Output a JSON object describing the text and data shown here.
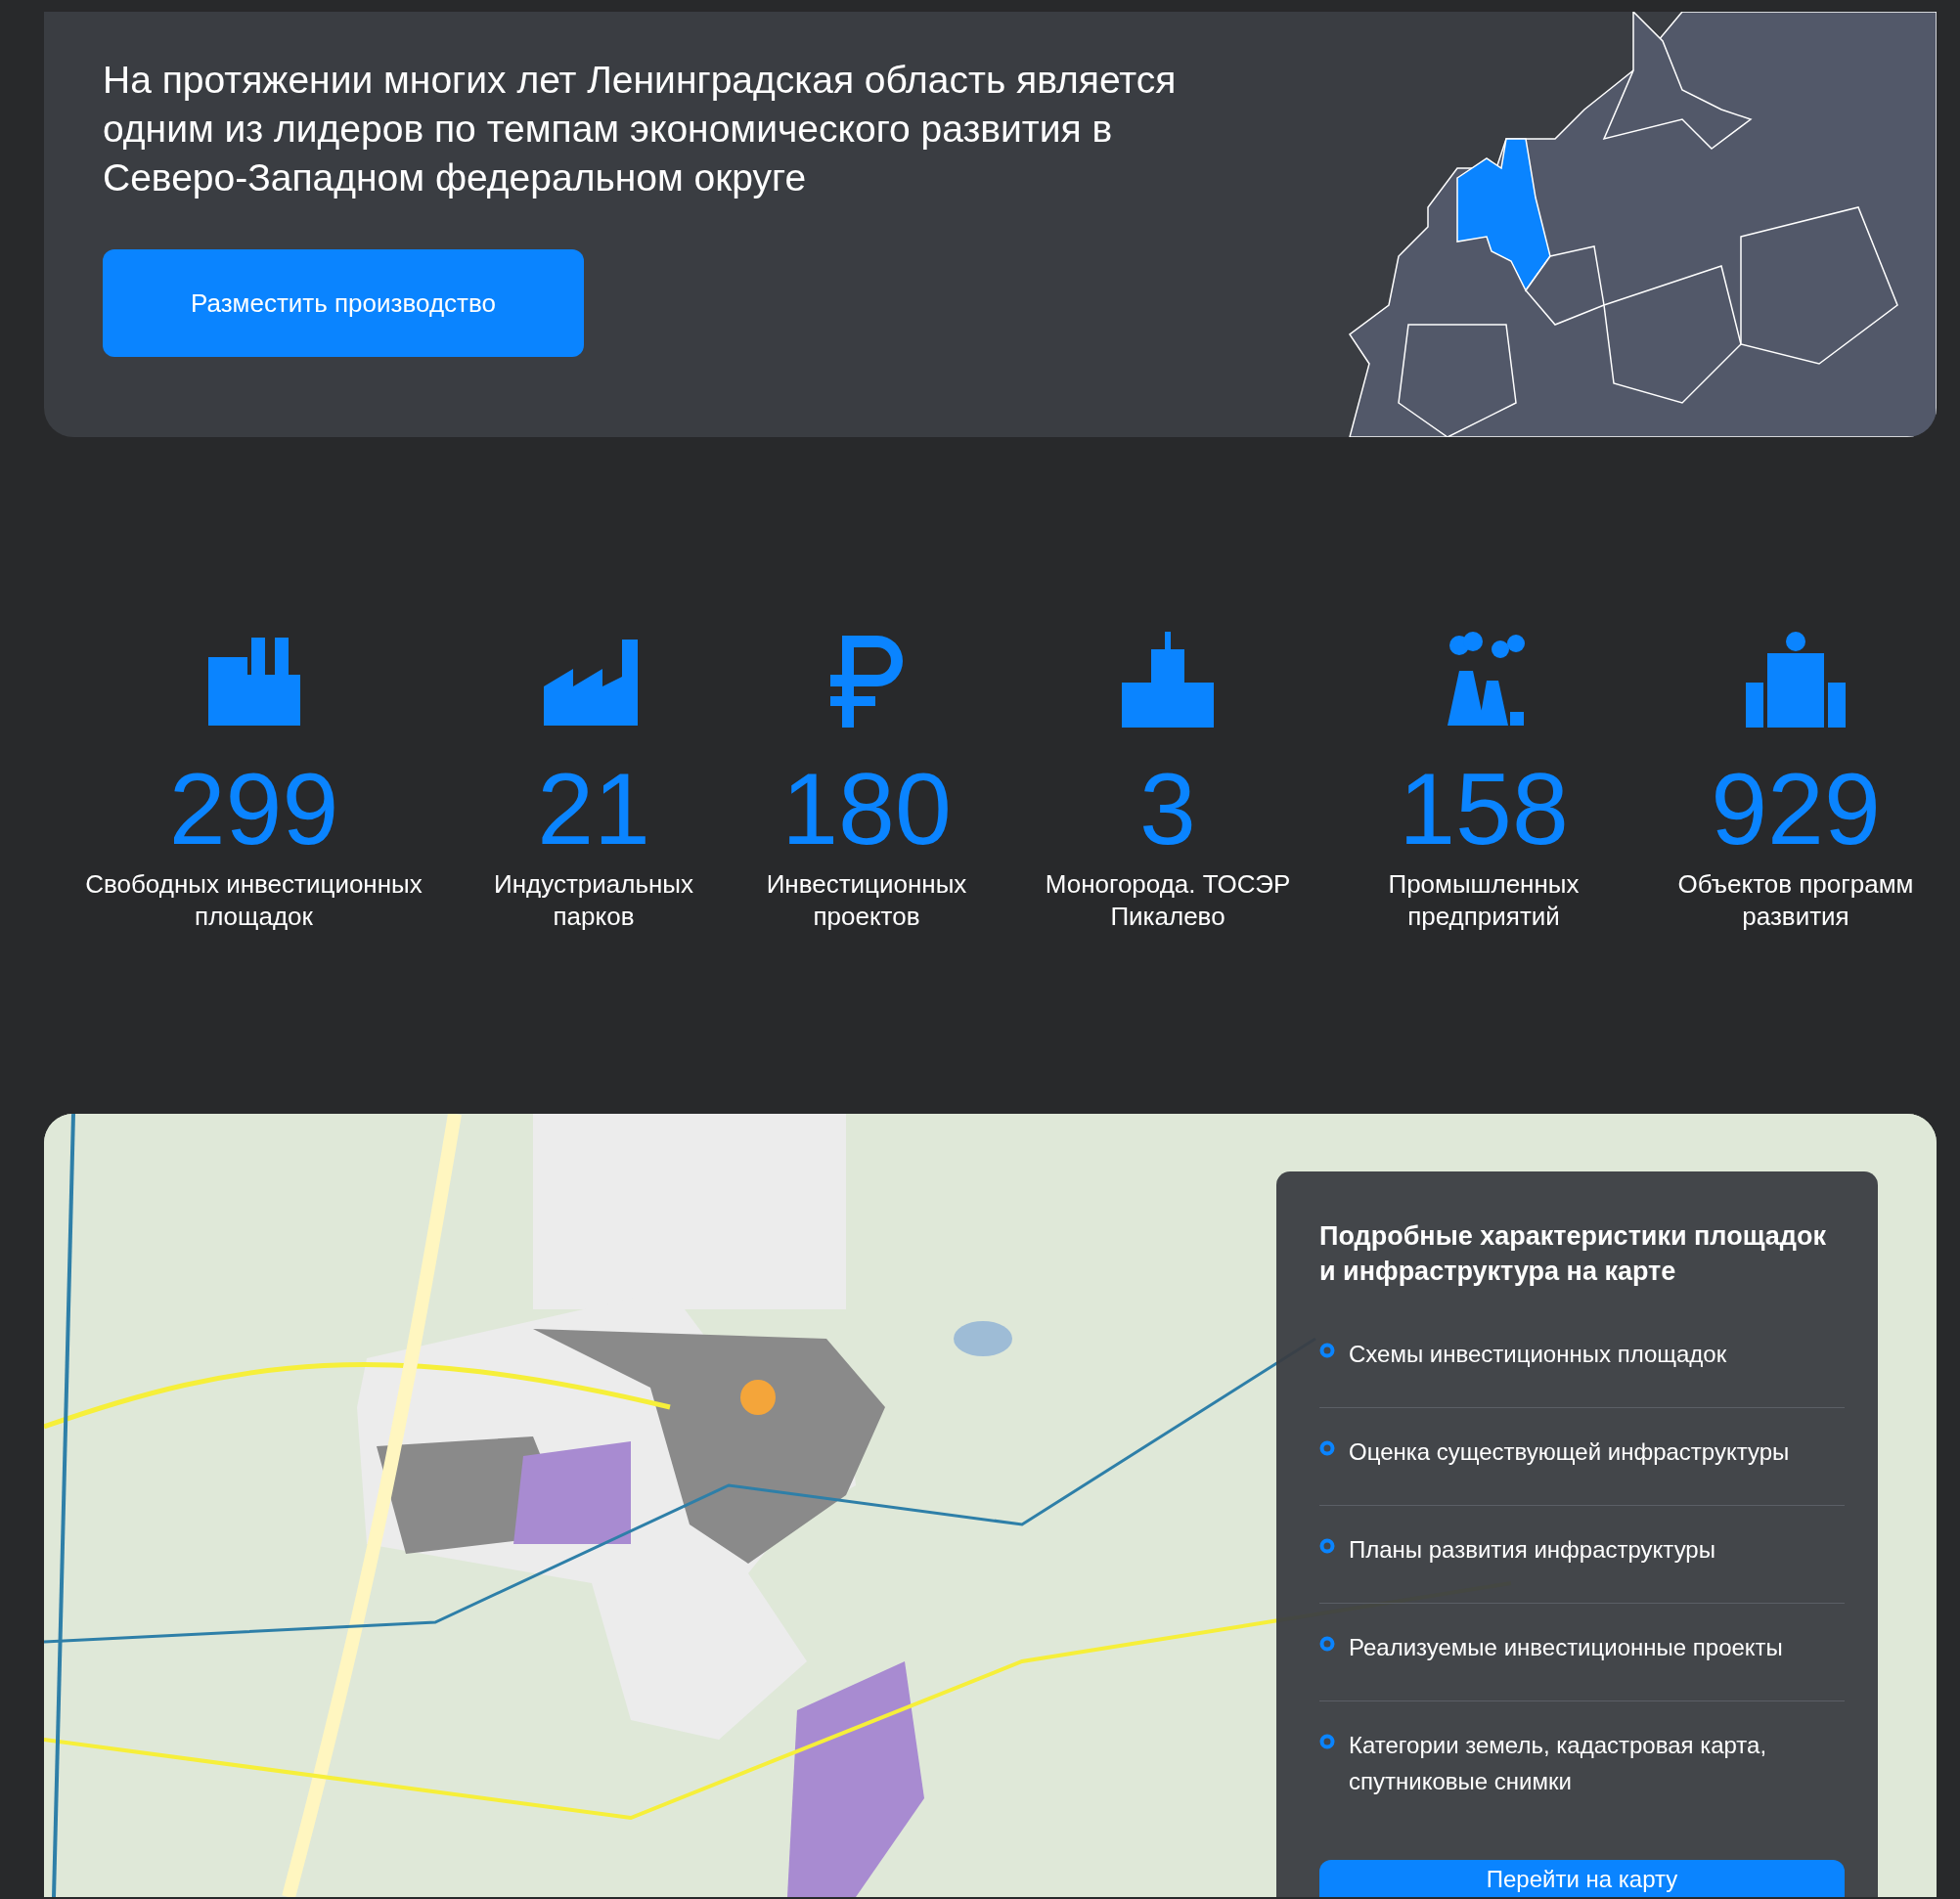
{
  "hero": {
    "heading": "На протяжении многих лет Ленинградская область является одним из лидеров по темпам экономического развития в Северо-Западном федеральном округе",
    "button": "Разместить производство"
  },
  "stats": [
    {
      "value": "299",
      "label": "Свободных инвестиционных площадок"
    },
    {
      "value": "21",
      "label": "Индустриальных парков"
    },
    {
      "value": "180",
      "label": "Инвестиционных проектов"
    },
    {
      "value": "3",
      "label": "Моногорода. ТОСЭР Пикалево"
    },
    {
      "value": "158",
      "label": "Промышленных предприятий"
    },
    {
      "value": "929",
      "label": "Объектов программ развития"
    }
  ],
  "map_panel": {
    "title": "Подробные характеристики площадок и инфраструктура на карте",
    "items": [
      "Схемы инвестиционных площадок",
      "Оценка существующей инфраструктуры",
      "Планы развития инфраструктуры",
      "Реализуемые инвестиционные проекты",
      "Категории земель, кадастровая карта, спутниковые снимки"
    ],
    "button": "Перейти на карту"
  }
}
